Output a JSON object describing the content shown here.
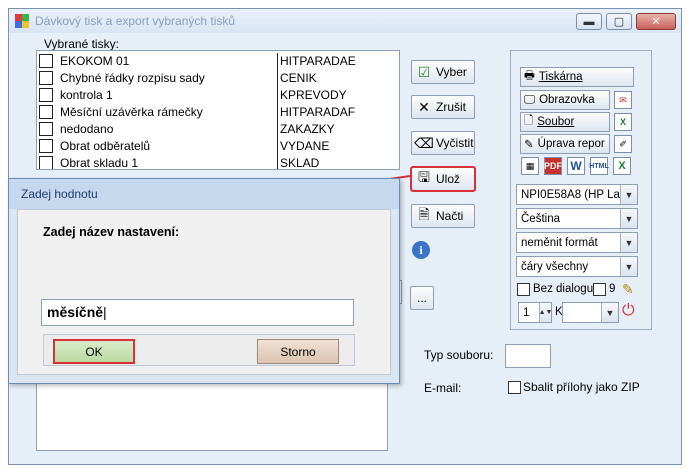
{
  "window": {
    "title": "Dávkový tisk a export vybraných tisků",
    "controls": [
      "minimize",
      "restore",
      "close"
    ]
  },
  "list": {
    "label": "Vybrané tisky:",
    "items": [
      {
        "name": "EKOKOM 01",
        "code": "HITPARADAE"
      },
      {
        "name": "Chybné řádky rozpisu sady",
        "code": "CENIK"
      },
      {
        "name": "kontrola 1",
        "code": "KPREVODY"
      },
      {
        "name": "Měsíční uzávěrka rámečky",
        "code": "HITPARADAF"
      },
      {
        "name": "nedodano",
        "code": "ZAKAZKY"
      },
      {
        "name": "Obrat odběratelů",
        "code": "VYDANE"
      },
      {
        "name": "Obrat skladu 1",
        "code": "SKLAD"
      }
    ]
  },
  "actions": {
    "vyber": "Vyber",
    "zrusit": "Zrušit",
    "vycistit": "Vyčistit",
    "uloz": "Ulož",
    "nacti": "Načti",
    "browse": "..."
  },
  "panel": {
    "tiskarna": "Tiskárna",
    "obrazovka": "Obrazovka",
    "soubor": "Soubor",
    "uprava": "Úprava repor",
    "format_icons": [
      "PDF",
      "W",
      "HTML",
      "X"
    ],
    "printer": "NPI0E58A8 (HP Lase",
    "language": "Čeština",
    "format": "neměnit formát",
    "lines": "čáry všechny",
    "bez_dialogu": "Bez dialogu",
    "nine": "9",
    "copies": "1",
    "k_label": "K"
  },
  "lower": {
    "typ_souboru": "Typ souboru:",
    "email": "E-mail:",
    "sbalit": "Sbalit přílohy jako ZIP"
  },
  "dialog": {
    "title": "Zadej hodnotu",
    "prompt": "Zadej název nastavení:",
    "value": "měsíčně",
    "ok": "OK",
    "storno": "Storno"
  },
  "colors": {
    "highlight": "#d9303a",
    "window_bg": "#e6eef7",
    "dialog_title": "#c6d8ee"
  }
}
